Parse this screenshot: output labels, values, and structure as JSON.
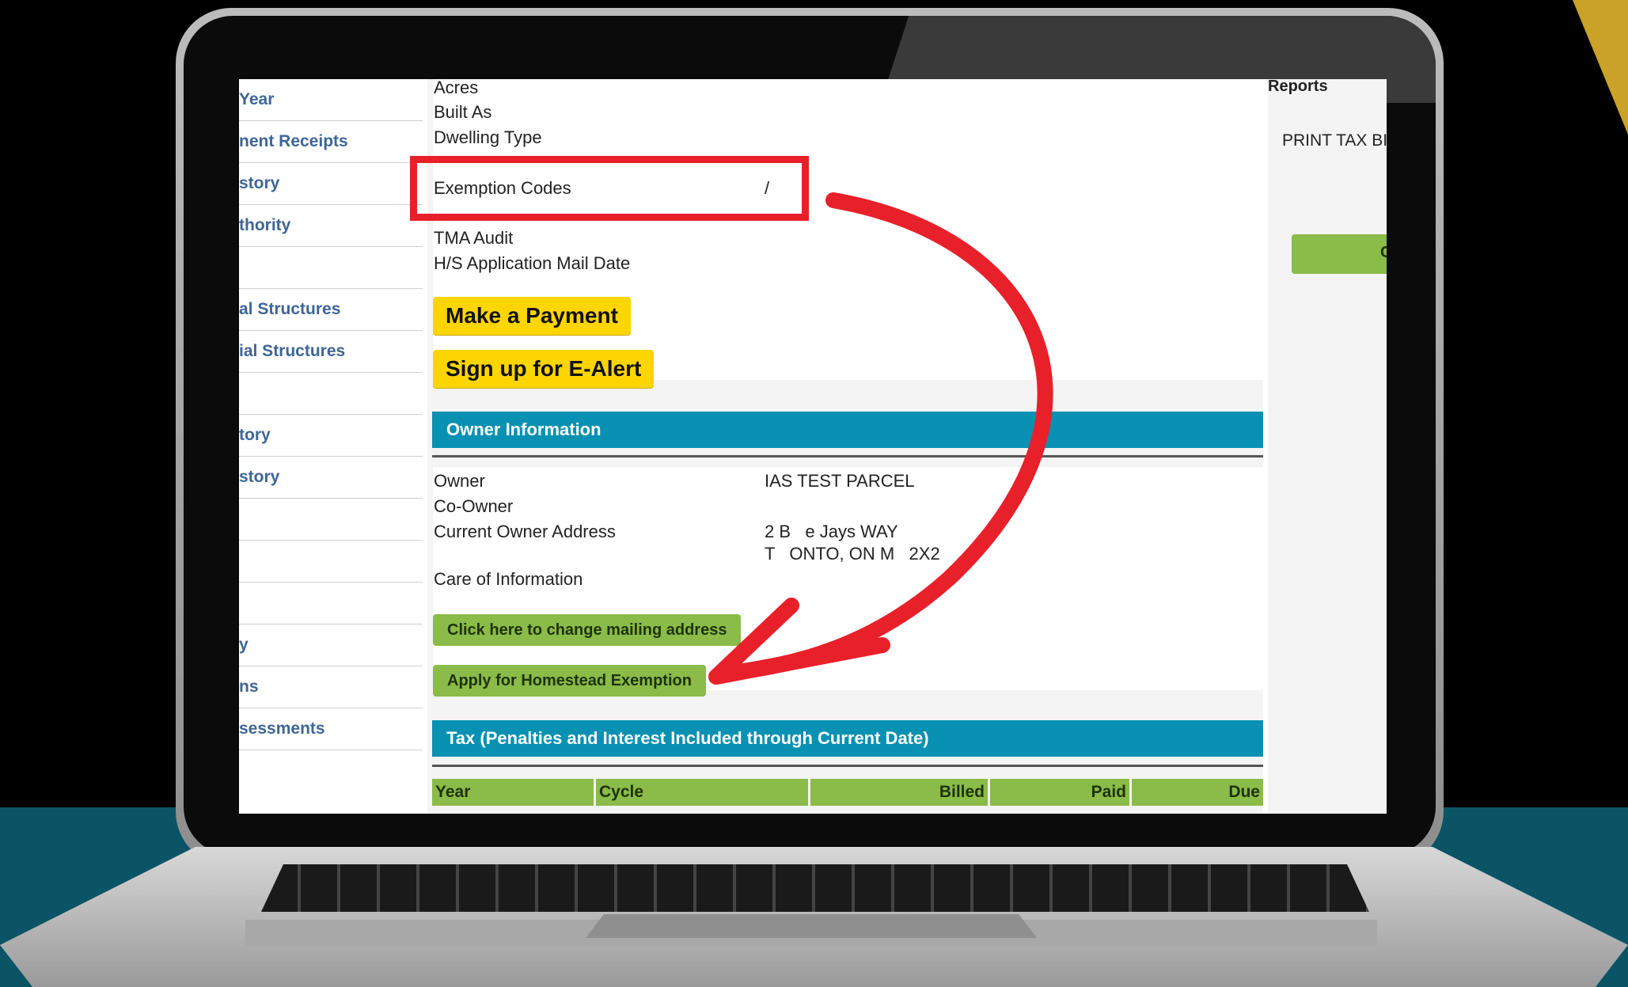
{
  "sidebar": {
    "items": [
      {
        "label": "Year"
      },
      {
        "label": "nent Receipts"
      },
      {
        "label": "story"
      },
      {
        "label": "thority"
      },
      {
        "label": ""
      },
      {
        "label": "al Structures"
      },
      {
        "label": "ial Structures"
      },
      {
        "label": ""
      },
      {
        "label": "tory"
      },
      {
        "label": "story"
      },
      {
        "label": ""
      },
      {
        "label": ""
      },
      {
        "label": ""
      },
      {
        "label": "y"
      },
      {
        "label": "ns"
      },
      {
        "label": "sessments"
      }
    ]
  },
  "property": {
    "acres_label": "Acres",
    "built_as_label": "Built As",
    "dwelling_type_label": "Dwelling Type",
    "exemption_codes_label": "Exemption Codes",
    "exemption_codes_value": "/",
    "tma_audit_label": "TMA Audit",
    "hs_mail_date_label": "H/S Application Mail Date"
  },
  "buttons": {
    "make_payment": "Make a Payment",
    "ealert": "Sign up for E-Alert",
    "change_mailing": "Click here to change mailing address",
    "homestead": "Apply for Homestead Exemption"
  },
  "owner_section": {
    "title": "Owner Information",
    "owner_label": "Owner",
    "owner_value": "IAS TEST PARCEL",
    "coowner_label": "Co-Owner",
    "address_label": "Current Owner Address",
    "address_line1": "2 B   e Jays WAY",
    "address_line2": "T   ONTO, ON M   2X2",
    "care_of_label": "Care of Information"
  },
  "tax_section": {
    "title": "Tax (Penalties and Interest Included through Current Date)",
    "columns": [
      "Year",
      "Cycle",
      "Billed",
      "Paid",
      "Due"
    ]
  },
  "right_panel": {
    "reports_label": "Reports",
    "print_label": "PRINT TAX BI",
    "button_label": "G"
  },
  "colors": {
    "annotation": "#e8202a",
    "section_header": "#0891b2",
    "green_button": "#8bbb48",
    "yellow_button": "#ffd500",
    "sidebar_link": "#3e6596"
  }
}
